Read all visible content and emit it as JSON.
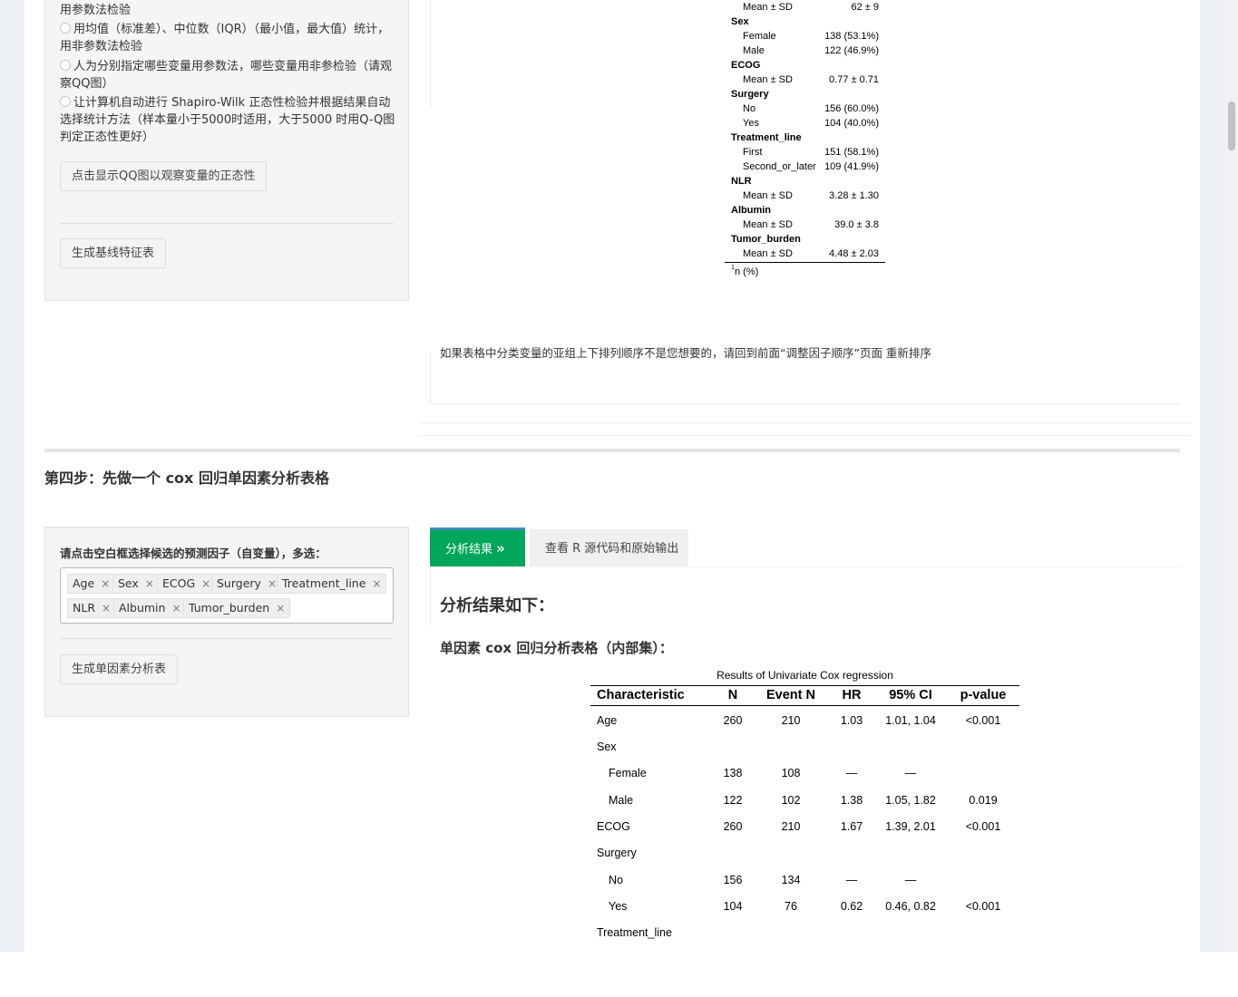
{
  "baseline_panel": {
    "radio_option_1_tail": "用参数法检验",
    "radio_option_2": "用均值（标准差）、中位数（IQR）（最小值，最大值）统计，用非参数法检验",
    "radio_option_3": "人为分别指定哪些变量用参数法，哪些变量用非参检验（请观察QQ图）",
    "radio_option_4": "让计算机自动进行 Shapiro-Wilk 正态性检验并根据结果自动选择统计方法（样本量小于5000时适用，大于5000 时用Q-Q图判定正态性更好）",
    "qq_button": "点击显示QQ图以观察变量的正态性",
    "generate_button": "生成基线特征表"
  },
  "baseline_table": {
    "rows": [
      {
        "label": "Mean ± SD",
        "value": "62 ± 9",
        "header": false
      },
      {
        "label": "Sex",
        "value": "",
        "header": true
      },
      {
        "label": "Female",
        "value": "138 (53.1%)",
        "header": false
      },
      {
        "label": "Male",
        "value": "122 (46.9%)",
        "header": false
      },
      {
        "label": "ECOG",
        "value": "",
        "header": true
      },
      {
        "label": "Mean ± SD",
        "value": "0.77 ± 0.71",
        "header": false
      },
      {
        "label": "Surgery",
        "value": "",
        "header": true
      },
      {
        "label": "No",
        "value": "156 (60.0%)",
        "header": false
      },
      {
        "label": "Yes",
        "value": "104 (40.0%)",
        "header": false
      },
      {
        "label": "Treatment_line",
        "value": "",
        "header": true
      },
      {
        "label": "First",
        "value": "151 (58.1%)",
        "header": false
      },
      {
        "label": "Second_or_later",
        "value": "109 (41.9%)",
        "header": false
      },
      {
        "label": "NLR",
        "value": "",
        "header": true
      },
      {
        "label": "Mean ± SD",
        "value": "3.28 ± 1.30",
        "header": false
      },
      {
        "label": "Albumin",
        "value": "",
        "header": true
      },
      {
        "label": "Mean ± SD",
        "value": "39.0 ± 3.8",
        "header": false
      },
      {
        "label": "Tumor_burden",
        "value": "",
        "header": true
      },
      {
        "label": "Mean ± SD",
        "value": "4.48 ± 2.03",
        "header": false
      }
    ],
    "footnote_mark": "1",
    "footnote": "n (%)"
  },
  "reorder_note": "如果表格中分类变量的亚组上下排列顺序不是您想要的，请回到前面“调整因子顺序”页面 重新排序",
  "step4": {
    "title": "第四步：先做一个 cox 回归单因素分析表格",
    "predictor_label": "请点击空白框选择候选的预测因子（自变量），多选：",
    "chips": [
      "Age",
      "Sex",
      "ECOG",
      "Surgery",
      "Treatment_line",
      "NLR",
      "Albumin",
      "Tumor_burden"
    ],
    "chip_remove": "×",
    "generate_button": "生成单因素分析表"
  },
  "tabs": {
    "active": "分析结果",
    "active_icon": "»",
    "inactive": "查看 R 源代码和原始输出"
  },
  "results": {
    "heading": "分析结果如下：",
    "subheading": "单因素 cox 回归分析表格（内部集）："
  },
  "cox_table": {
    "caption": "Results of Univariate Cox regression",
    "headers": [
      "Characteristic",
      "N",
      "Event N",
      "HR",
      "95% CI",
      "p-value"
    ],
    "rows": [
      {
        "char": "Age",
        "indent": false,
        "n": "260",
        "event": "210",
        "hr": "1.03",
        "ci": "1.01, 1.04",
        "p": "<0.001"
      },
      {
        "char": "Sex",
        "indent": false,
        "n": "",
        "event": "",
        "hr": "",
        "ci": "",
        "p": ""
      },
      {
        "char": "Female",
        "indent": true,
        "n": "138",
        "event": "108",
        "hr": "—",
        "ci": "—",
        "p": ""
      },
      {
        "char": "Male",
        "indent": true,
        "n": "122",
        "event": "102",
        "hr": "1.38",
        "ci": "1.05, 1.82",
        "p": "0.019"
      },
      {
        "char": "ECOG",
        "indent": false,
        "n": "260",
        "event": "210",
        "hr": "1.67",
        "ci": "1.39, 2.01",
        "p": "<0.001"
      },
      {
        "char": "Surgery",
        "indent": false,
        "n": "",
        "event": "",
        "hr": "",
        "ci": "",
        "p": ""
      },
      {
        "char": "No",
        "indent": true,
        "n": "156",
        "event": "134",
        "hr": "—",
        "ci": "—",
        "p": ""
      },
      {
        "char": "Yes",
        "indent": true,
        "n": "104",
        "event": "76",
        "hr": "0.62",
        "ci": "0.46, 0.82",
        "p": "<0.001"
      },
      {
        "char": "Treatment_line",
        "indent": false,
        "n": "",
        "event": "",
        "hr": "",
        "ci": "",
        "p": ""
      }
    ]
  }
}
